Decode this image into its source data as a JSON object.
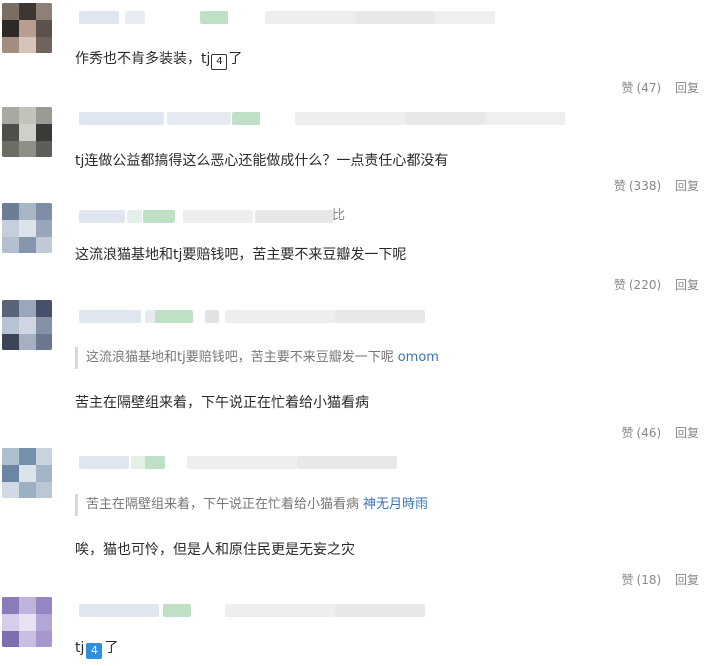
{
  "comments": [
    {
      "text": "作秀也不肯多装装，tj",
      "badge": "4",
      "text_after": "了",
      "actions": {
        "like_label": "赞",
        "like_count": "(47)",
        "reply_label": "回复"
      }
    },
    {
      "text": "tj连做公益都搞得这么恶心还能做成什么？一点责任心都没有",
      "actions": {
        "like_label": "赞",
        "like_count": "(338)",
        "reply_label": "回复"
      }
    },
    {
      "name_fragment": "比",
      "text": "这流浪猫基地和tj要赔钱吧，苦主要不来豆瓣发一下呢",
      "actions": {
        "like_label": "赞",
        "like_count": "(220)",
        "reply_label": "回复"
      }
    },
    {
      "quote": {
        "text": "这流浪猫基地和tj要赔钱吧，苦主要不来豆瓣发一下呢",
        "author": "omom"
      },
      "text": "苦主在隔壁组来着，下午说正在忙着给小猫看病",
      "actions": {
        "like_label": "赞",
        "like_count": "(46)",
        "reply_label": "回复"
      }
    },
    {
      "quote": {
        "text": "苦主在隔壁组来着，下午说正在忙着给小猫看病",
        "author": "神无月時雨"
      },
      "text": "唉，猫也可怜，但是人和原住民更是无妄之灾",
      "actions": {
        "like_label": "赞",
        "like_count": "(18)",
        "reply_label": "回复"
      }
    },
    {
      "text": "tj",
      "badge": "4",
      "text_after": "了"
    }
  ]
}
